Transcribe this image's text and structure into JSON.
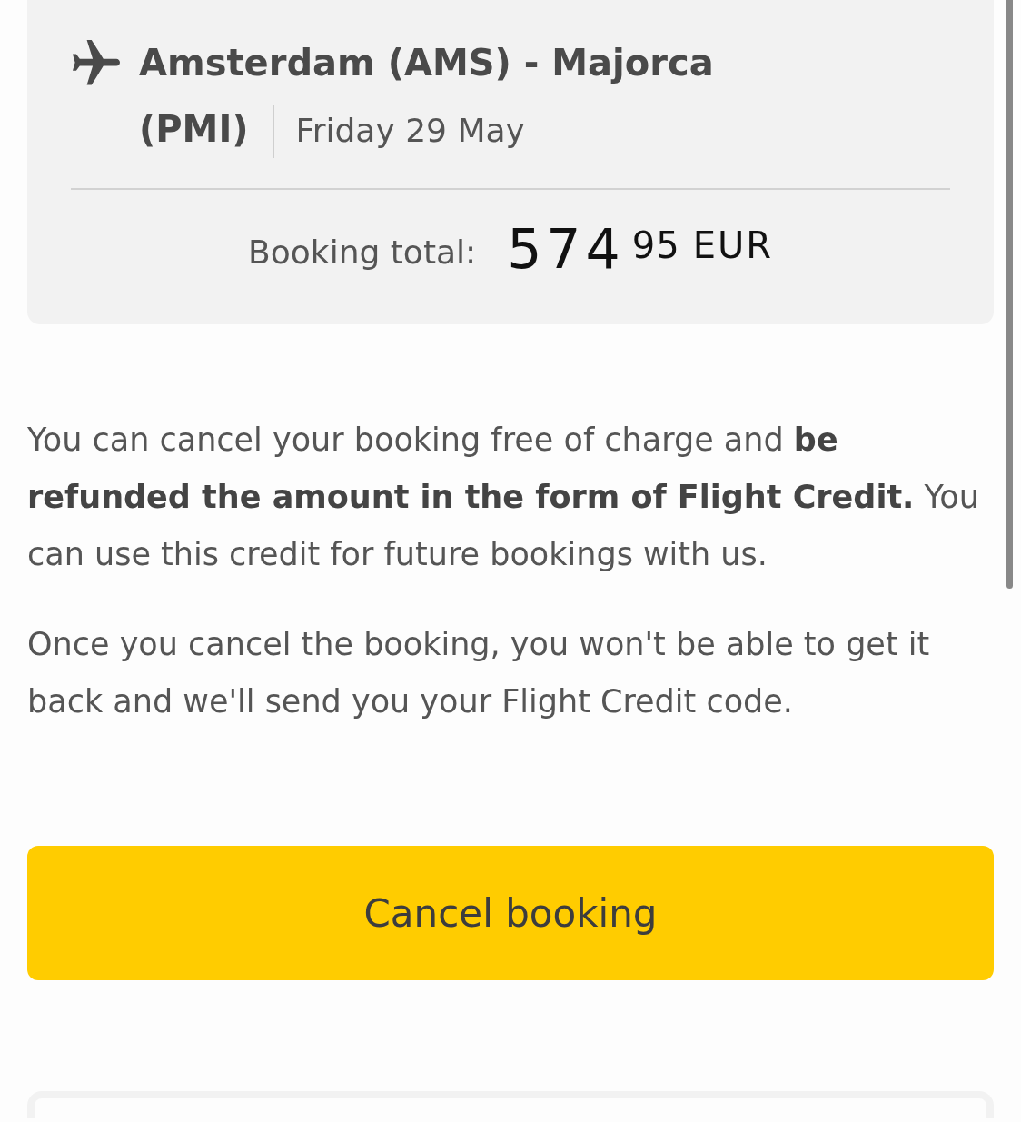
{
  "flight": {
    "route": "Amsterdam (AMS) - Majorca (PMI)",
    "date": "Friday 29 May"
  },
  "booking_total": {
    "label": "Booking total:",
    "amount_whole": "574",
    "amount_decimal": "95",
    "currency": "EUR"
  },
  "paragraphs": [
    "You can cancel your booking free of charge and **be refunded the amount in the form of Flight Credit.** You can use this credit for future bookings with us.",
    "Once you cancel the booking, you won't be able to get it back and we'll send you your Flight Credit code."
  ],
  "cancel_button": {
    "label": "Cancel booking"
  }
}
